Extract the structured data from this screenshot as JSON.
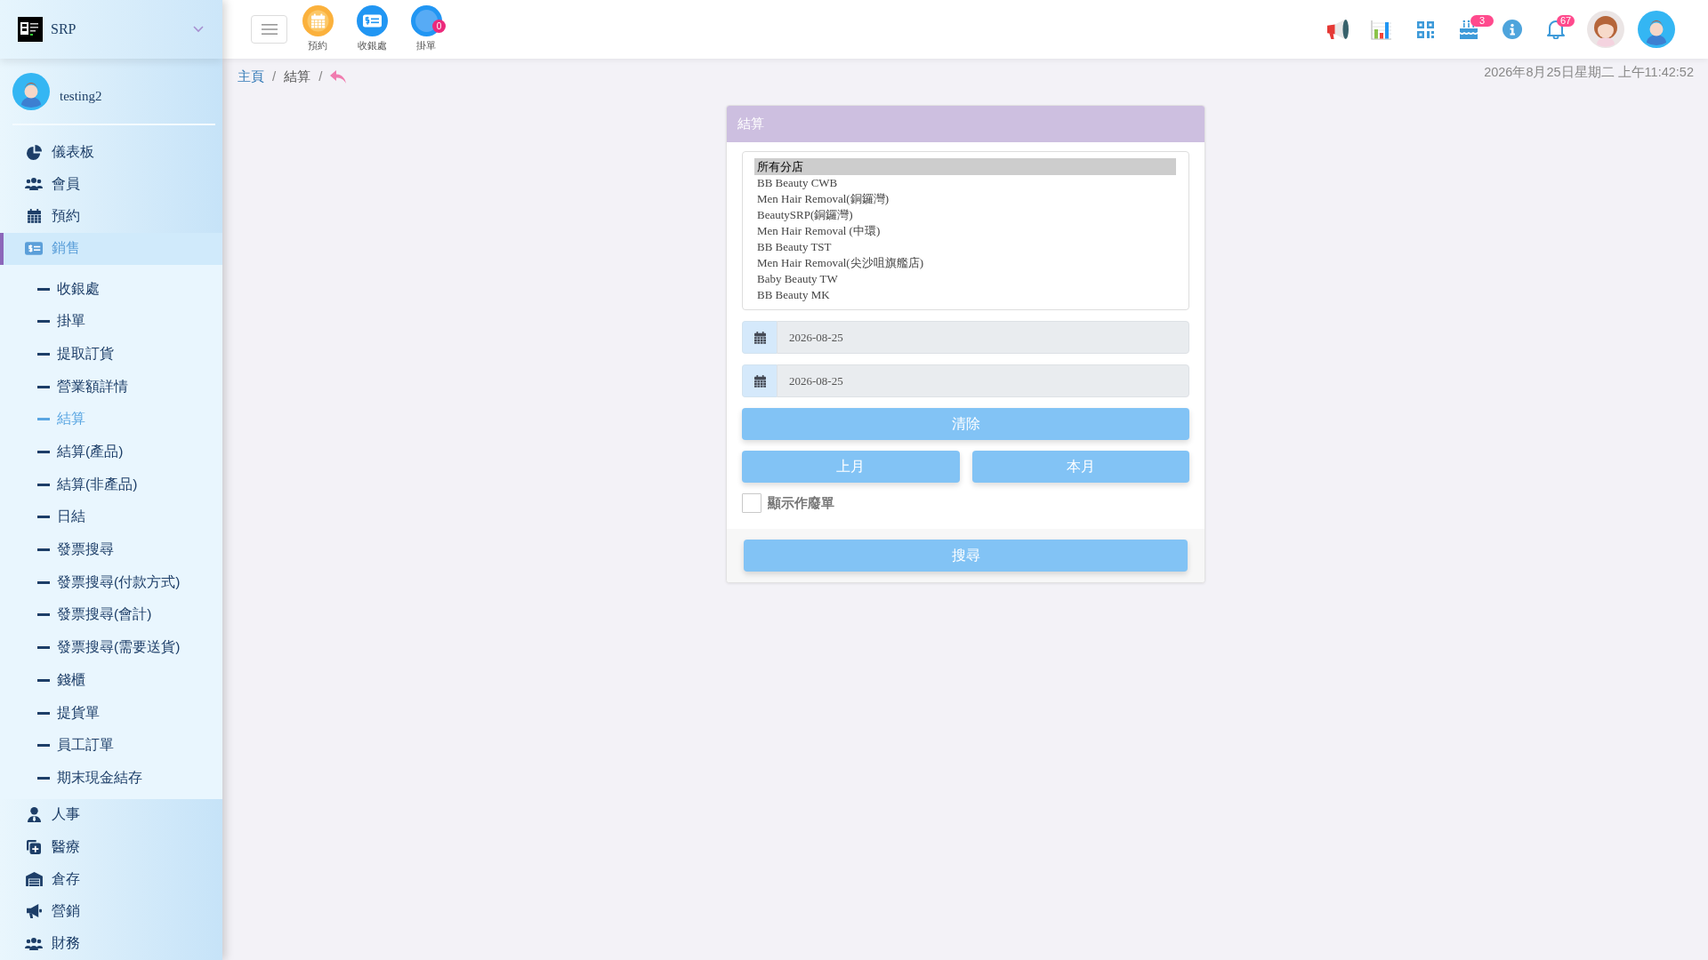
{
  "sidebar": {
    "brand": "SRP",
    "user": {
      "name": "testing2"
    },
    "menu": [
      {
        "label": "儀表板",
        "selected": false
      },
      {
        "label": "會員",
        "selected": false
      },
      {
        "label": "預約",
        "selected": false
      },
      {
        "label": "銷售",
        "selected": true,
        "children": [
          {
            "label": "收銀處",
            "selected": false
          },
          {
            "label": "掛單",
            "selected": false
          },
          {
            "label": "提取訂貨",
            "selected": false
          },
          {
            "label": "營業額詳情",
            "selected": false
          },
          {
            "label": "結算",
            "selected": true
          },
          {
            "label": "結算(產品)",
            "selected": false
          },
          {
            "label": "結算(非產品)",
            "selected": false
          },
          {
            "label": "日結",
            "selected": false
          },
          {
            "label": "發票搜尋",
            "selected": false
          },
          {
            "label": "發票搜尋(付款方式)",
            "selected": false
          },
          {
            "label": "發票搜尋(會計)",
            "selected": false
          },
          {
            "label": "發票搜尋(需要送貨)",
            "selected": false
          },
          {
            "label": "錢櫃",
            "selected": false
          },
          {
            "label": "提貨單",
            "selected": false
          },
          {
            "label": "員工訂單",
            "selected": false
          },
          {
            "label": "期末現金結存",
            "selected": false
          }
        ]
      },
      {
        "label": "人事",
        "selected": false
      },
      {
        "label": "醫療",
        "selected": false
      },
      {
        "label": "倉存",
        "selected": false
      },
      {
        "label": "營銷",
        "selected": false
      },
      {
        "label": "財務",
        "selected": false
      }
    ]
  },
  "topbar": {
    "shortcuts": [
      {
        "kind": "booking",
        "label": "預約"
      },
      {
        "kind": "cashier",
        "label": "收銀處"
      },
      {
        "kind": "pending",
        "label": "掛單",
        "badge": "0"
      }
    ],
    "toolbar": [
      {
        "kind": "announcements"
      },
      {
        "kind": "reports"
      },
      {
        "kind": "scanner"
      },
      {
        "kind": "birthdays",
        "badge": "3"
      },
      {
        "kind": "info"
      },
      {
        "kind": "notifications",
        "badge": "67"
      },
      {
        "kind": "staff_avatar"
      },
      {
        "kind": "user_avatar"
      }
    ]
  },
  "breadcrumb": [
    {
      "kind": "link",
      "text": "主頁"
    },
    {
      "kind": "separator",
      "text": "/"
    },
    {
      "kind": "current",
      "text": "結算"
    },
    {
      "kind": "separator",
      "text": "/"
    },
    {
      "kind": "back"
    }
  ],
  "datetime": "2026年8月25日星期二 上午11:42:52",
  "settlement_card": {
    "title": "結算",
    "branches": [
      {
        "label": "所有分店",
        "selected": true
      },
      {
        "label": "BB Beauty CWB",
        "selected": false
      },
      {
        "label": "Men Hair Removal(銅鑼灣)",
        "selected": false
      },
      {
        "label": "BeautySRP(銅鑼灣)",
        "selected": false
      },
      {
        "label": "Men Hair Removal (中環)",
        "selected": false
      },
      {
        "label": "BB Beauty TST",
        "selected": false
      },
      {
        "label": "Men Hair Removal(尖沙咀旗艦店)",
        "selected": false
      },
      {
        "label": "Baby Beauty TW",
        "selected": false
      },
      {
        "label": "BB Beauty MK",
        "selected": false
      }
    ],
    "date_from": {
      "value": "2026-08-25"
    },
    "date_to": {
      "value": "2026-08-25"
    },
    "clear_button": {
      "label": "清除"
    },
    "month_buttons": [
      {
        "label": "上月"
      },
      {
        "label": "本月"
      }
    ],
    "show_void": {
      "label": "顯示作廢單",
      "checked": false
    },
    "search_button": {
      "label": "搜尋"
    }
  }
}
